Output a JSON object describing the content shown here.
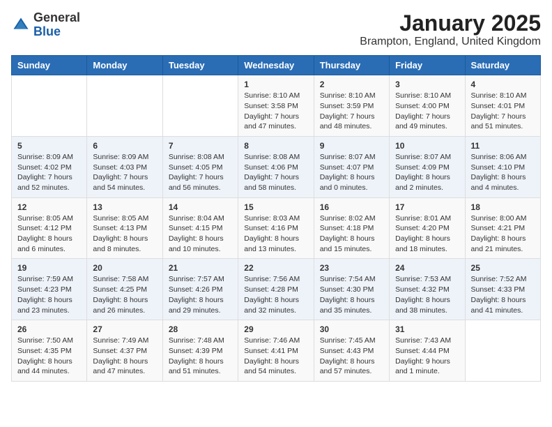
{
  "logo": {
    "general": "General",
    "blue": "Blue"
  },
  "title": "January 2025",
  "subtitle": "Brampton, England, United Kingdom",
  "weekdays": [
    "Sunday",
    "Monday",
    "Tuesday",
    "Wednesday",
    "Thursday",
    "Friday",
    "Saturday"
  ],
  "weeks": [
    [
      {
        "day": "",
        "info": ""
      },
      {
        "day": "",
        "info": ""
      },
      {
        "day": "",
        "info": ""
      },
      {
        "day": "1",
        "info": "Sunrise: 8:10 AM\nSunset: 3:58 PM\nDaylight: 7 hours and 47 minutes."
      },
      {
        "day": "2",
        "info": "Sunrise: 8:10 AM\nSunset: 3:59 PM\nDaylight: 7 hours and 48 minutes."
      },
      {
        "day": "3",
        "info": "Sunrise: 8:10 AM\nSunset: 4:00 PM\nDaylight: 7 hours and 49 minutes."
      },
      {
        "day": "4",
        "info": "Sunrise: 8:10 AM\nSunset: 4:01 PM\nDaylight: 7 hours and 51 minutes."
      }
    ],
    [
      {
        "day": "5",
        "info": "Sunrise: 8:09 AM\nSunset: 4:02 PM\nDaylight: 7 hours and 52 minutes."
      },
      {
        "day": "6",
        "info": "Sunrise: 8:09 AM\nSunset: 4:03 PM\nDaylight: 7 hours and 54 minutes."
      },
      {
        "day": "7",
        "info": "Sunrise: 8:08 AM\nSunset: 4:05 PM\nDaylight: 7 hours and 56 minutes."
      },
      {
        "day": "8",
        "info": "Sunrise: 8:08 AM\nSunset: 4:06 PM\nDaylight: 7 hours and 58 minutes."
      },
      {
        "day": "9",
        "info": "Sunrise: 8:07 AM\nSunset: 4:07 PM\nDaylight: 8 hours and 0 minutes."
      },
      {
        "day": "10",
        "info": "Sunrise: 8:07 AM\nSunset: 4:09 PM\nDaylight: 8 hours and 2 minutes."
      },
      {
        "day": "11",
        "info": "Sunrise: 8:06 AM\nSunset: 4:10 PM\nDaylight: 8 hours and 4 minutes."
      }
    ],
    [
      {
        "day": "12",
        "info": "Sunrise: 8:05 AM\nSunset: 4:12 PM\nDaylight: 8 hours and 6 minutes."
      },
      {
        "day": "13",
        "info": "Sunrise: 8:05 AM\nSunset: 4:13 PM\nDaylight: 8 hours and 8 minutes."
      },
      {
        "day": "14",
        "info": "Sunrise: 8:04 AM\nSunset: 4:15 PM\nDaylight: 8 hours and 10 minutes."
      },
      {
        "day": "15",
        "info": "Sunrise: 8:03 AM\nSunset: 4:16 PM\nDaylight: 8 hours and 13 minutes."
      },
      {
        "day": "16",
        "info": "Sunrise: 8:02 AM\nSunset: 4:18 PM\nDaylight: 8 hours and 15 minutes."
      },
      {
        "day": "17",
        "info": "Sunrise: 8:01 AM\nSunset: 4:20 PM\nDaylight: 8 hours and 18 minutes."
      },
      {
        "day": "18",
        "info": "Sunrise: 8:00 AM\nSunset: 4:21 PM\nDaylight: 8 hours and 21 minutes."
      }
    ],
    [
      {
        "day": "19",
        "info": "Sunrise: 7:59 AM\nSunset: 4:23 PM\nDaylight: 8 hours and 23 minutes."
      },
      {
        "day": "20",
        "info": "Sunrise: 7:58 AM\nSunset: 4:25 PM\nDaylight: 8 hours and 26 minutes."
      },
      {
        "day": "21",
        "info": "Sunrise: 7:57 AM\nSunset: 4:26 PM\nDaylight: 8 hours and 29 minutes."
      },
      {
        "day": "22",
        "info": "Sunrise: 7:56 AM\nSunset: 4:28 PM\nDaylight: 8 hours and 32 minutes."
      },
      {
        "day": "23",
        "info": "Sunrise: 7:54 AM\nSunset: 4:30 PM\nDaylight: 8 hours and 35 minutes."
      },
      {
        "day": "24",
        "info": "Sunrise: 7:53 AM\nSunset: 4:32 PM\nDaylight: 8 hours and 38 minutes."
      },
      {
        "day": "25",
        "info": "Sunrise: 7:52 AM\nSunset: 4:33 PM\nDaylight: 8 hours and 41 minutes."
      }
    ],
    [
      {
        "day": "26",
        "info": "Sunrise: 7:50 AM\nSunset: 4:35 PM\nDaylight: 8 hours and 44 minutes."
      },
      {
        "day": "27",
        "info": "Sunrise: 7:49 AM\nSunset: 4:37 PM\nDaylight: 8 hours and 47 minutes."
      },
      {
        "day": "28",
        "info": "Sunrise: 7:48 AM\nSunset: 4:39 PM\nDaylight: 8 hours and 51 minutes."
      },
      {
        "day": "29",
        "info": "Sunrise: 7:46 AM\nSunset: 4:41 PM\nDaylight: 8 hours and 54 minutes."
      },
      {
        "day": "30",
        "info": "Sunrise: 7:45 AM\nSunset: 4:43 PM\nDaylight: 8 hours and 57 minutes."
      },
      {
        "day": "31",
        "info": "Sunrise: 7:43 AM\nSunset: 4:44 PM\nDaylight: 9 hours and 1 minute."
      },
      {
        "day": "",
        "info": ""
      }
    ]
  ]
}
